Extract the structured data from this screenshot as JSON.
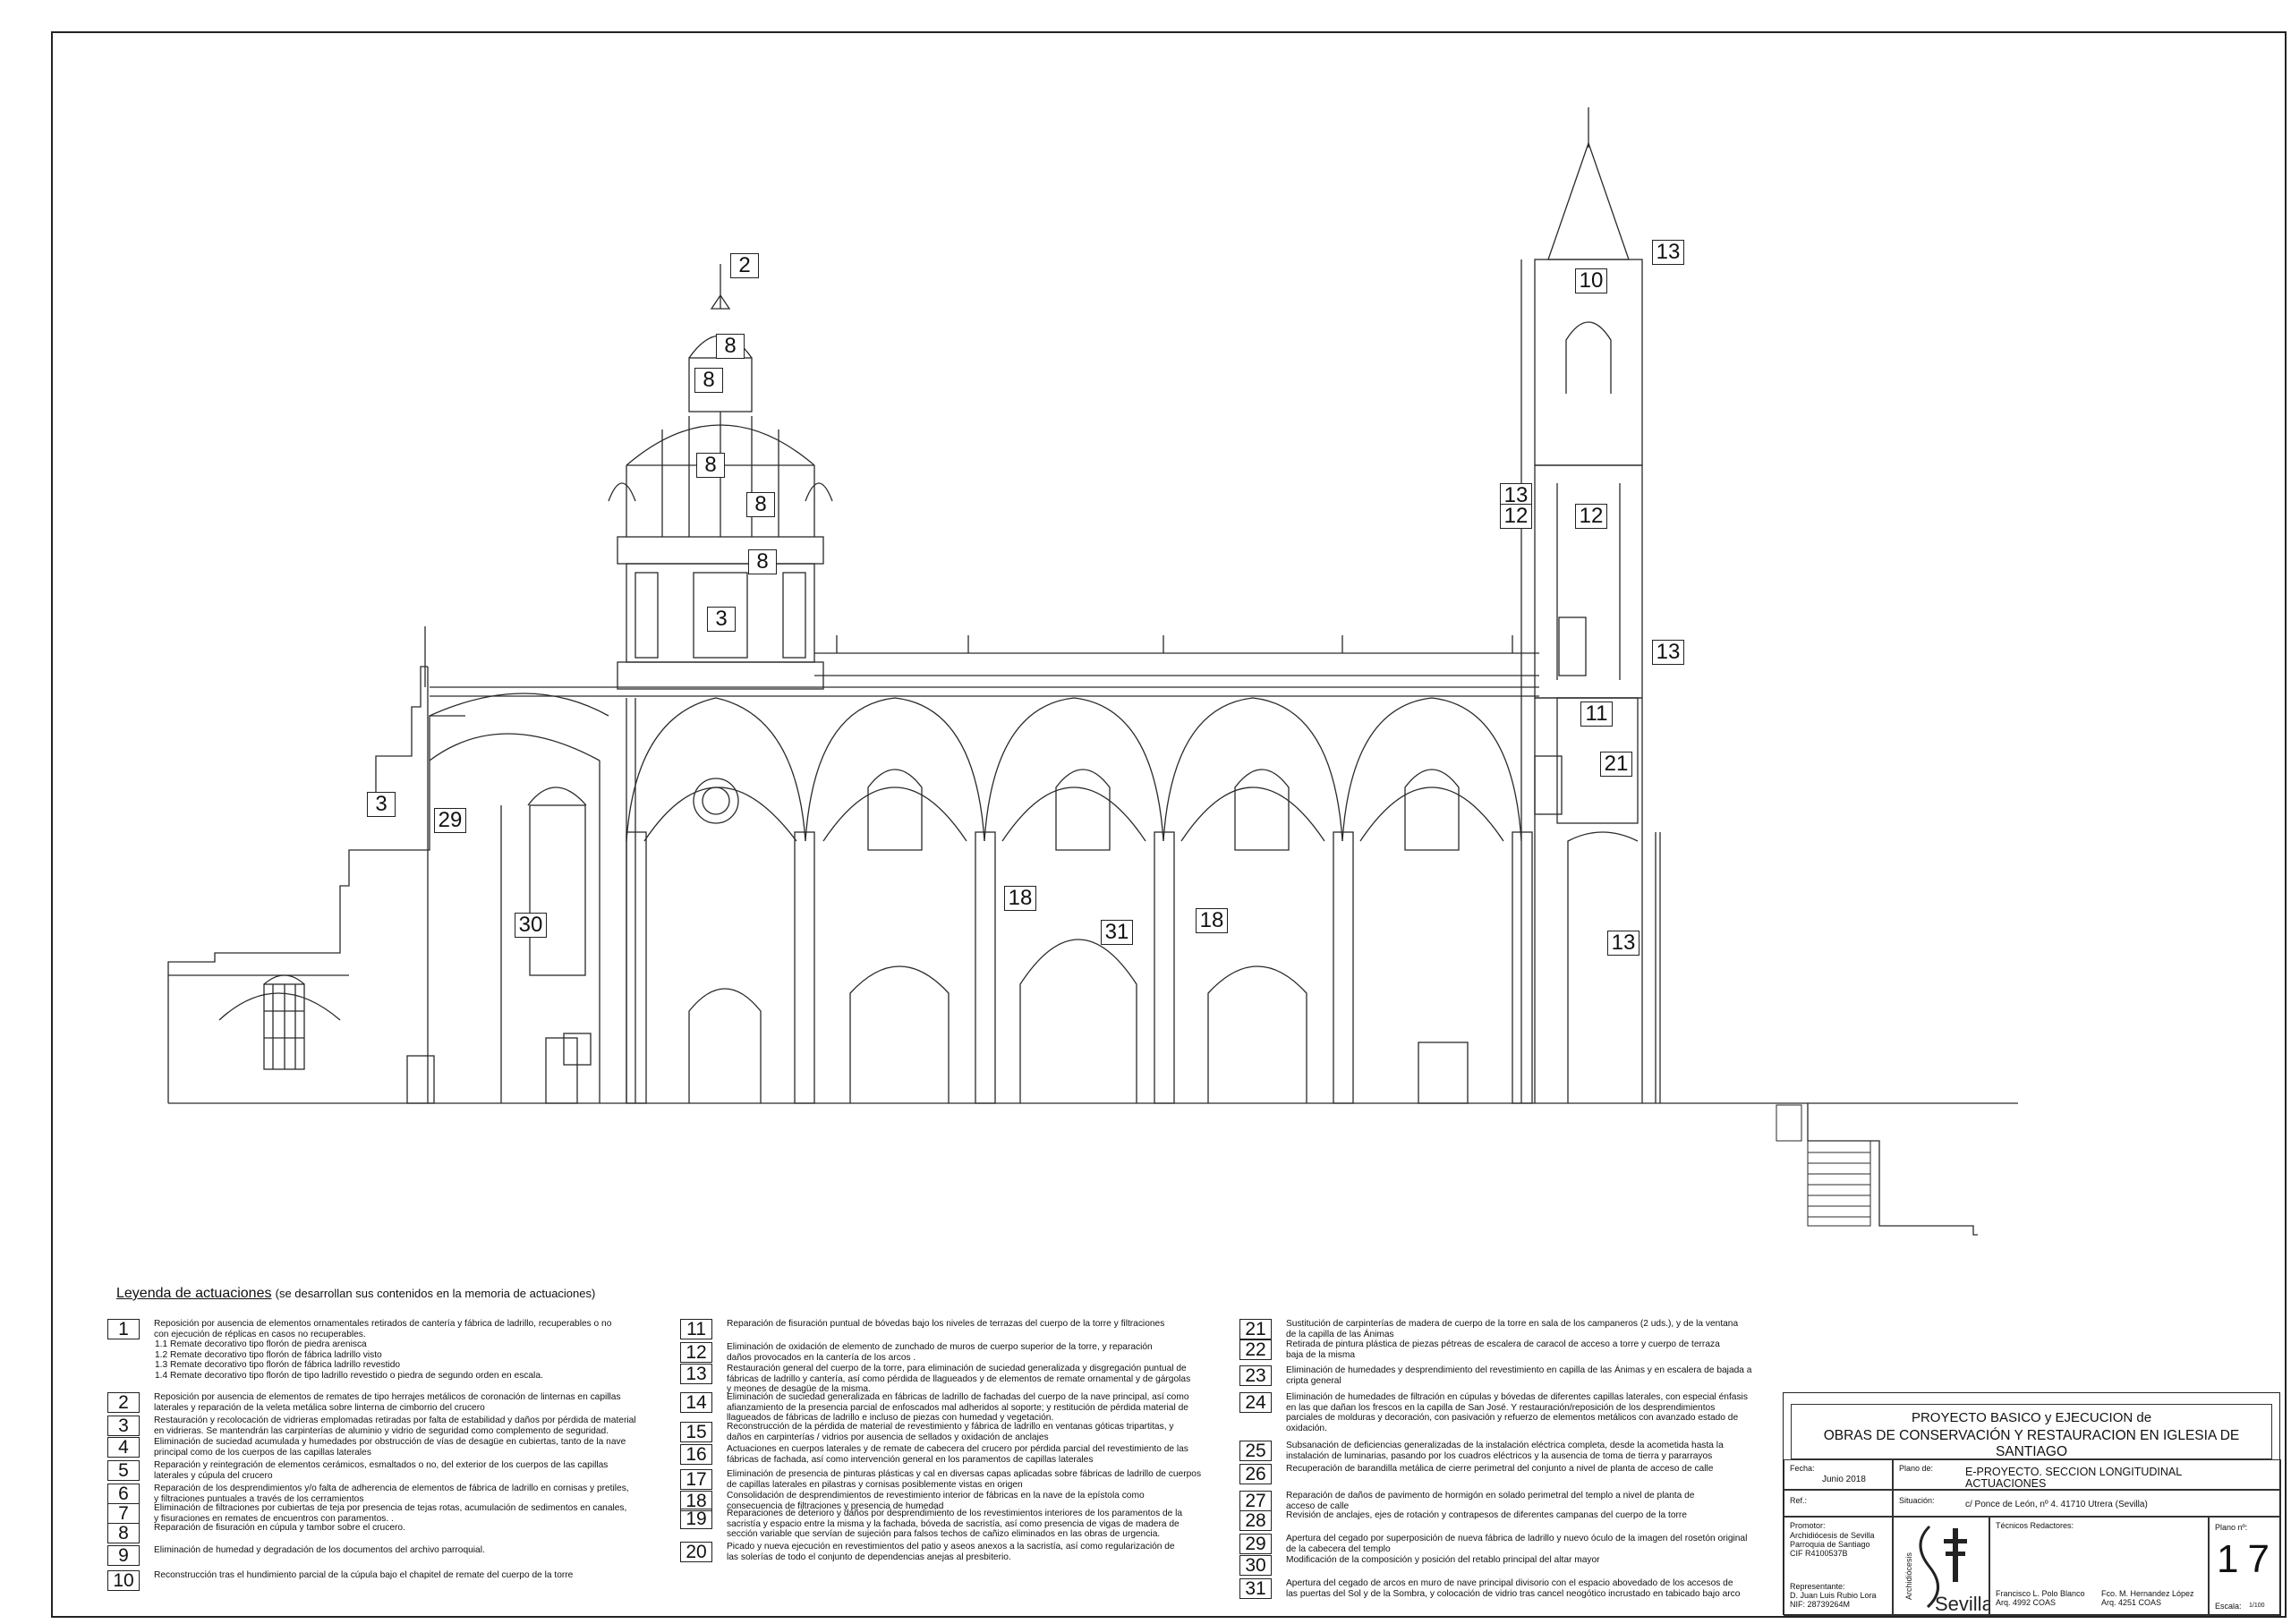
{
  "callouts": {
    "c_2_top": "2",
    "c_8_a": "8",
    "c_8_b": "8",
    "c_8_c": "8",
    "c_8_d": "8",
    "c_8_e": "8",
    "c_3_dome": "3",
    "c_3_left": "3",
    "c_29": "29",
    "c_30": "30",
    "c_18_a": "18",
    "c_18_b": "18",
    "c_31": "31",
    "c_10": "10",
    "c_13_a": "13",
    "c_13_b": "13",
    "c_12_a": "12",
    "c_12_b": "12",
    "c_13_c": "13",
    "c_11": "11",
    "c_21": "21",
    "c_13_d": "13"
  },
  "legend": {
    "title": "Leyenda de actuaciones",
    "subtitle": "(se desarrollan sus contenidos en la memoria de actuaciones)",
    "items": [
      {
        "n": "1",
        "lines": [
          "Reposición por ausencia de elementos ornamentales retirados de cantería y fábrica de ladrillo, recuperables o no",
          "con ejecución de réplicas en casos no recuperables."
        ],
        "subs": [
          "1.1 Remate decorativo tipo florón de piedra arenisca",
          "1.2 Remate decorativo tipo florón de fábrica ladrillo visto",
          "1.3 Remate decorativo tipo florón de fábrica ladrillo revestido",
          "1.4 Remate decorativo tipo florón de tipo ladrillo revestido o piedra de segundo orden en escala."
        ]
      },
      {
        "n": "2",
        "lines": [
          "Reposición por ausencia de elementos de remates de tipo herrajes metálicos de coronación de linternas en capillas",
          "laterales y reparación de la veleta metálica sobre linterna de cimborrio del crucero"
        ]
      },
      {
        "n": "3",
        "lines": [
          "Restauración y recolocación de vidrieras emplomadas retiradas por falta de estabilidad y daños por pérdida de material",
          "en vidrieras. Se mantendrán las carpinterías de aluminio y vidrio de seguridad como complemento de seguridad."
        ]
      },
      {
        "n": "4",
        "lines": [
          "Eliminación de suciedad acumulada y humedades por obstrucción de vías de desagüe en cubiertas, tanto de la nave",
          "principal como de los cuerpos de las capillas laterales"
        ]
      },
      {
        "n": "5",
        "lines": [
          "Reparación y reintegración de elementos cerámicos, esmaltados o no, del exterior de los cuerpos de las capillas",
          "laterales y cúpula del crucero"
        ]
      },
      {
        "n": "6",
        "lines": [
          "Reparación de los desprendimientos y/o falta de adherencia de elementos de fábrica de ladrillo en cornisas y pretiles,",
          "y filtraciones puntuales a través de los cerramientos"
        ]
      },
      {
        "n": "7",
        "lines": [
          "Eliminación de filtraciones por cubiertas de teja por presencia de tejas rotas, acumulación de sedimentos en canales,",
          "y fisuraciones en remates de encuentros con paramentos. ."
        ]
      },
      {
        "n": "8",
        "lines": [
          "Reparación de fisuración en cúpula y tambor sobre el crucero."
        ]
      },
      {
        "n": "9",
        "lines": [
          "Eliminación de humedad y degradación de los documentos del archivo parroquial."
        ]
      },
      {
        "n": "10",
        "lines": [
          "Reconstrucción tras el hundimiento parcial de la cúpula bajo el chapitel de remate del cuerpo de la torre"
        ]
      },
      {
        "n": "11",
        "lines": [
          "Reparación de fisuración puntual de bóvedas bajo los niveles de terrazas del cuerpo de la torre y filtraciones"
        ]
      },
      {
        "n": "12",
        "lines": [
          "Eliminación de oxidación de elemento de zunchado de muros de cuerpo superior de la torre, y reparación",
          "daños provocados en la cantería de los arcos ."
        ]
      },
      {
        "n": "13",
        "lines": [
          "Restauración general del cuerpo de la torre, para eliminación de suciedad generalizada y disgregación puntual de",
          "fábricas de ladrillo y cantería, así como pérdida de llagueados y de elementos de remate ornamental y de gárgolas",
          "y meones de desagüe de la misma."
        ]
      },
      {
        "n": "14",
        "lines": [
          "Eliminación de suciedad generalizada en fábricas de ladrillo de fachadas del cuerpo de la nave principal, así como",
          "afianzamiento de la presencia parcial de enfoscados  mal adheridos al soporte; y restitución de pérdida material de",
          "llagueados de  fábricas de ladrillo e incluso de piezas con humedad y vegetación."
        ]
      },
      {
        "n": "15",
        "lines": [
          "Reconstrucción de la pérdida de material de revestimiento y fábrica de ladrillo en ventanas góticas tripartitas, y",
          "daños en carpinterías / vidrios por ausencia de sellados y oxidación de anclajes"
        ]
      },
      {
        "n": "16",
        "lines": [
          "Actuaciones en cuerpos laterales y de remate de cabecera del crucero por pérdida parcial del revestimiento de las",
          "fábricas de fachada, así como intervención general en los paramentos de capillas laterales"
        ]
      },
      {
        "n": "17",
        "lines": [
          "Eliminación de presencia de pinturas plásticas y cal en diversas capas aplicadas sobre fábricas de ladrillo de cuerpos",
          "de capillas laterales en pilastras y cornisas posiblemente vistas en origen"
        ]
      },
      {
        "n": "18",
        "lines": [
          "Consolidación de desprendimientos de revestimiento interior de fábricas en la nave de la epístola como",
          "consecuencia de filtraciones y presencia de humedad"
        ]
      },
      {
        "n": "19",
        "lines": [
          "Reparaciones de deterioro y daños por desprendimiento de los revestimientos interiores de los paramentos de la",
          "sacristía y espacio entre la misma y la fachada, bóveda de sacristía, así como presencia de vigas de madera de",
          "sección variable que servían de sujeción para falsos techos de cañizo eliminados en las obras de urgencia."
        ]
      },
      {
        "n": "20",
        "lines": [
          "Picado y nueva ejecución en revestimientos del patio y aseos anexos a la sacristía, así como regularización de",
          "las solerías de todo el conjunto de dependencias anejas al presbiterio."
        ]
      },
      {
        "n": "21",
        "lines": [
          "Sustitución de carpinterías de madera de cuerpo de la torre en sala de los campaneros (2 uds.), y de la ventana",
          "de la capilla de las Ánimas"
        ]
      },
      {
        "n": "22",
        "lines": [
          "Retirada de pintura plástica de piezas pétreas de escalera de caracol de acceso a torre y cuerpo de terraza",
          "baja de la misma"
        ]
      },
      {
        "n": "23",
        "lines": [
          "Eliminación de humedades y desprendimiento del revestimiento en capilla de las Ánimas y en escalera de bajada a",
          "cripta general"
        ]
      },
      {
        "n": "24",
        "lines": [
          "Eliminación de humedades de filtración en cúpulas y bóvedas de diferentes capillas laterales, con especial énfasis",
          "en las que dañan los frescos en la capilla de San José. Y restauración/reposición de los desprendimientos",
          "parciales de molduras y decoración, con pasivación y refuerzo de elementos metálicos con avanzado estado de",
          "oxidación."
        ]
      },
      {
        "n": "25",
        "lines": [
          "Subsanación de deficiencias generalizadas de la instalación eléctrica completa, desde la acometida hasta la",
          "instalación de luminarias, pasando por los cuadros eléctricos y la ausencia de toma de tierra y pararrayos"
        ]
      },
      {
        "n": "26",
        "lines": [
          "Recuperación de barandilla metálica de cierre perimetral del conjunto a nivel de planta de acceso de calle"
        ]
      },
      {
        "n": "27",
        "lines": [
          "Reparación de daños de pavimento de hormigón en solado perimetral del templo a nivel de planta de",
          "acceso de calle"
        ]
      },
      {
        "n": "28",
        "lines": [
          "Revisión de anclajes, ejes de rotación y contrapesos de diferentes campanas del cuerpo de la torre"
        ]
      },
      {
        "n": "29",
        "lines": [
          "Apertura del cegado por superposición de nueva fábrica de ladrillo y nuevo óculo de la imagen del rosetón original",
          "de la cabecera del templo"
        ]
      },
      {
        "n": "30",
        "lines": [
          "Modificación de la composición y posición del retablo principal del altar mayor"
        ]
      },
      {
        "n": "31",
        "lines": [
          "Apertura del cegado de arcos en muro de nave principal divisorio con el espacio abovedado de los accesos de",
          "las puertas del Sol y de la Sombra, y colocación de vidrio tras cancel neogótico incrustado en tabicado bajo arco"
        ]
      }
    ]
  },
  "title_block": {
    "project_line1": "PROYECTO BASICO y EJECUCION de",
    "project_line2": "OBRAS DE CONSERVACIÓN Y RESTAURACION EN IGLESIA DE SANTIAGO",
    "fecha_label": "Fecha:",
    "fecha_value": "Junio 2018",
    "plano_de_label": "Plano de:",
    "plano_de_line1": "E-PROYECTO. SECCION LONGITUDINAL",
    "plano_de_line2": "ACTUACIONES",
    "ref_label": "Ref.:",
    "situacion_label": "Situación:",
    "situacion_value": "c/ Ponce de León, nº 4. 41710 Utrera (Sevilla)",
    "promotor_label": "Promotor:",
    "promotor_line1": "Archidiócesis de Sevilla",
    "promotor_line2": "Parroquia de Santiago",
    "promotor_line3": "CIF R4100537B",
    "representante_label": "Representante:",
    "representante_line1": "D. Juan Luis Rubio Lora",
    "representante_line2": "NIF: 28739264M",
    "logo_text_vertical": "Archidiócesis",
    "logo_text_main": "Sevilla",
    "tecnicos_label": "Técnicos Redactores:",
    "tecnico1_name": "Francisco L. Polo Blanco",
    "tecnico1_reg": "Arq. 4992 COAS",
    "tecnico2_name": "Fco. M. Hernandez López",
    "tecnico2_reg": "Arq. 4251 COAS",
    "plano_n_label": "Plano nº:",
    "plano_n_value": "17",
    "escala_label": "Escala:",
    "escala_value": "1/100"
  },
  "colors": {
    "line": "#2a2a2a",
    "fine": "#777777"
  }
}
